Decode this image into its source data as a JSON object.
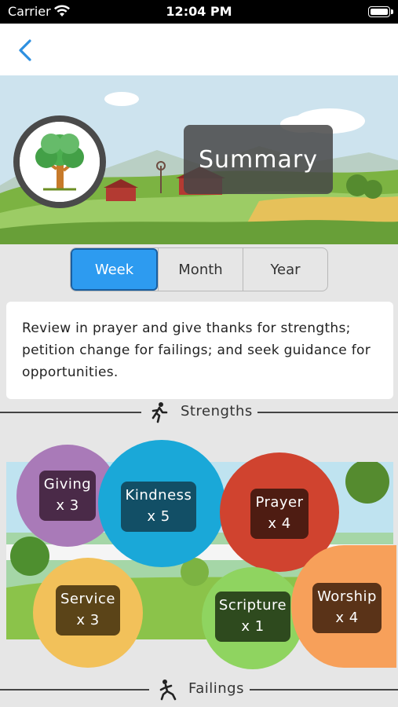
{
  "status_bar": {
    "carrier": "Carrier",
    "time": "12:04 PM"
  },
  "nav": {
    "back_icon": "chevron-left-icon"
  },
  "header": {
    "title": "Summary"
  },
  "periods": [
    "Week",
    "Month",
    "Year"
  ],
  "selected_period": "Week",
  "description": "Review in prayer and give thanks for strengths; petition change for failings; and seek guidance for opportunities.",
  "sections": {
    "strengths": "Strengths",
    "failings": "Failings"
  },
  "strengths": [
    {
      "name": "Giving",
      "count": "x 3",
      "color": "#a97ab8",
      "chip": "#4a2a48"
    },
    {
      "name": "Kindness",
      "count": "x 5",
      "color": "#1aa8d8",
      "chip": "#124f66"
    },
    {
      "name": "Prayer",
      "count": "x 4",
      "color": "#d0432f",
      "chip": "#4e1c12"
    },
    {
      "name": "Service",
      "count": "x 3",
      "color": "#f2c15a",
      "chip": "#5b4418"
    },
    {
      "name": "Scripture",
      "count": "x 1",
      "color": "#8fd460",
      "chip": "#2e4a1e"
    },
    {
      "name": "Worship",
      "count": "x 4",
      "color": "#f7a05a",
      "chip": "#5a3318"
    }
  ],
  "colors": {
    "accent": "#2d9bf0",
    "background": "#e6e6e6"
  }
}
